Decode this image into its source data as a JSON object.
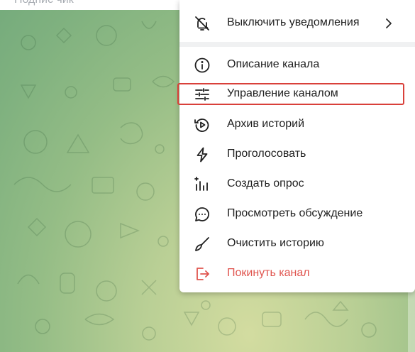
{
  "header": {
    "search_placeholder": "Подпис чик"
  },
  "menu": {
    "items": [
      {
        "label": "Выключить уведомления",
        "icon": "mute-bell-icon",
        "has_submenu": true
      },
      {
        "label": "Описание канала",
        "icon": "info-icon"
      },
      {
        "label": "Управление каналом",
        "icon": "settings-sliders-icon",
        "highlighted": true
      },
      {
        "label": "Архив историй",
        "icon": "story-archive-icon"
      },
      {
        "label": "Проголосовать",
        "icon": "lightning-icon"
      },
      {
        "label": "Создать опрос",
        "icon": "poll-icon"
      },
      {
        "label": "Просмотреть обсуждение",
        "icon": "discussion-icon"
      },
      {
        "label": "Очистить историю",
        "icon": "broom-icon"
      },
      {
        "label": "Покинуть канал",
        "icon": "leave-icon",
        "danger": true
      }
    ]
  },
  "colors": {
    "highlight_border": "#d9403a",
    "danger_text": "#e0554f",
    "menu_background": "#ffffff"
  }
}
